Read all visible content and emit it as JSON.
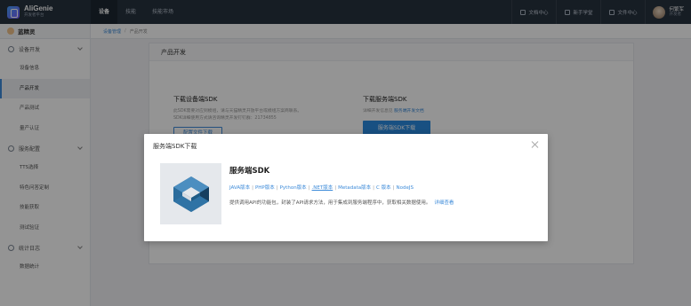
{
  "header": {
    "logo_title": "AliGenie",
    "logo_subtitle": "开发者平台",
    "nav": [
      {
        "label": "设备",
        "active": true
      },
      {
        "label": "技能",
        "active": false
      },
      {
        "label": "技能市场",
        "active": false
      }
    ],
    "links": [
      "文档中心",
      "新手学堂",
      "文件中心"
    ],
    "user": {
      "name": "何繁军",
      "sub": "开发者"
    }
  },
  "sidebar": {
    "head": "蓝精灵",
    "groups": [
      {
        "label": "设备开发",
        "items": [
          "设备信息",
          "产品开发",
          "产品测试",
          "量产认证"
        ]
      },
      {
        "label": "服务配置",
        "items": [
          "TTS选择",
          "特色问答定制",
          "技能获取",
          "测试验证"
        ]
      },
      {
        "label": "统计日志",
        "items": [
          "数据统计"
        ]
      }
    ],
    "active_item": "产品开发"
  },
  "breadcrumb": [
    "设备管理",
    "产品开发"
  ],
  "panel": {
    "title": "产品开发",
    "device_sdk": {
      "title": "下载设备端SDK",
      "desc1": "此SDK需要对应到模组，请与天猫精灵开放平台或模组方案商联系。",
      "desc2": "SDK详细使用方式请咨询精灵开发钉钉群：21734855",
      "button": "配置文件下载"
    },
    "server_sdk": {
      "title": "下载服务端SDK",
      "desc_prefix": "详细开发信息见",
      "desc_link": "服务端开发文档",
      "button": "服务端SDK下载"
    }
  },
  "modal": {
    "title": "服务端SDK下载",
    "sdk_name": "服务端SDK",
    "langs": [
      "JAVA版本",
      "PHP版本",
      "Python版本",
      ".NET版本",
      "Metadata版本",
      "C 版本",
      "NodeJS"
    ],
    "desc": "提供调用API的功能包，封装了API请求方法，用于集成到服务端程序中，获取相关数据使用。",
    "detail_link": "详细查看"
  }
}
